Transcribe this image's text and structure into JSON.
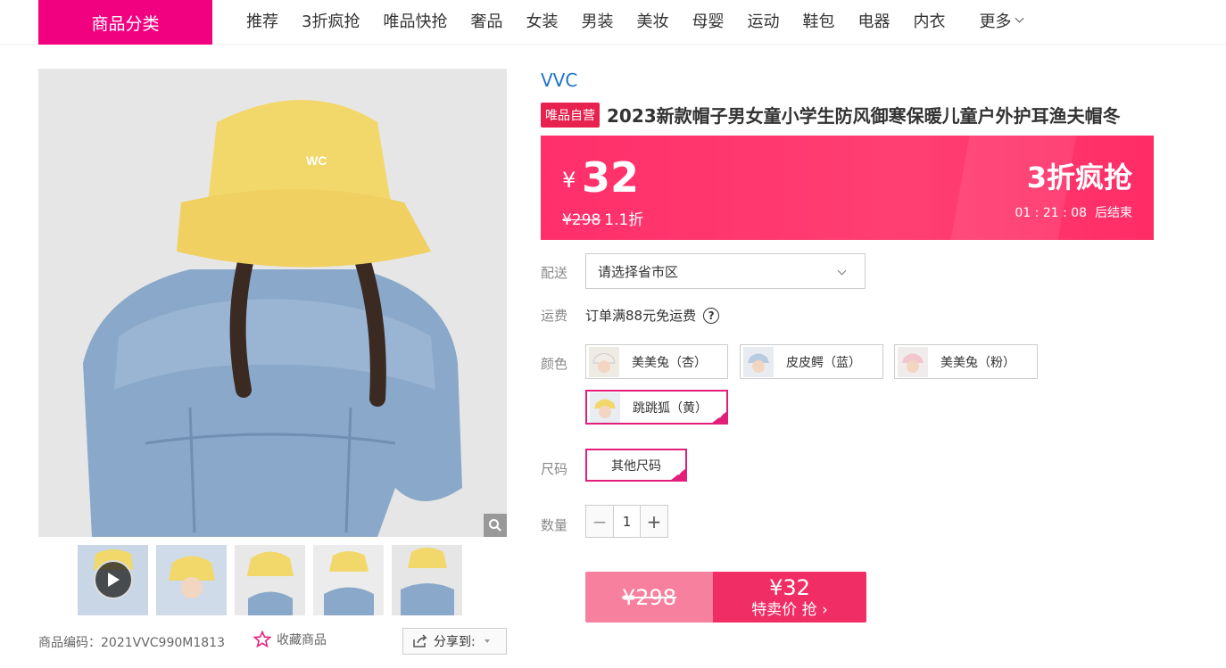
{
  "nav": {
    "category_button": "商品分类",
    "items": [
      "推荐",
      "3折疯抢",
      "唯品快抢",
      "奢品",
      "女装",
      "男装",
      "美妆",
      "母婴",
      "运动",
      "鞋包",
      "电器",
      "内衣"
    ],
    "more": "更多"
  },
  "product": {
    "brand": "VVC",
    "self_tag": "唯品自营",
    "title": "2023新款帽子男女童小学生防风御寒保暖儿童户外护耳渔夫帽冬",
    "image_logo": "WC",
    "code_label": "商品编码：",
    "code": "2021VVC990M1813",
    "favorite": "收藏商品",
    "share": "分享到:"
  },
  "price": {
    "currency": "¥",
    "current": "32",
    "original": "¥298",
    "discount": "1.1折",
    "promo": "3折疯抢",
    "countdown": "01 : 21 : 08",
    "countdown_suffix": "后结束"
  },
  "delivery": {
    "label": "配送",
    "placeholder": "请选择省市区"
  },
  "shipping": {
    "label": "运费",
    "text": "订单满88元免运费"
  },
  "colors": {
    "label": "颜色",
    "options": [
      "美美兔（杏）",
      "皮皮鳄（蓝）",
      "美美兔（粉）",
      "跳跳狐（黄）"
    ],
    "selected": "跳跳狐（黄）"
  },
  "size": {
    "label": "尺码",
    "option": "其他尺码"
  },
  "quantity": {
    "label": "数量",
    "minus": "−",
    "value": "1",
    "plus": "+"
  },
  "buy": {
    "original": "¥298",
    "price": "¥32",
    "label": "特卖价 抢"
  },
  "thumbnails": [
    "video-thumb",
    "thumb-2",
    "thumb-3",
    "thumb-4",
    "thumb-5"
  ],
  "colors_theme": {
    "brand_pink": "#f10180",
    "price_bar": "#ff2f6b",
    "selected_border": "#e21e7a",
    "link_blue": "#1e73c8"
  }
}
